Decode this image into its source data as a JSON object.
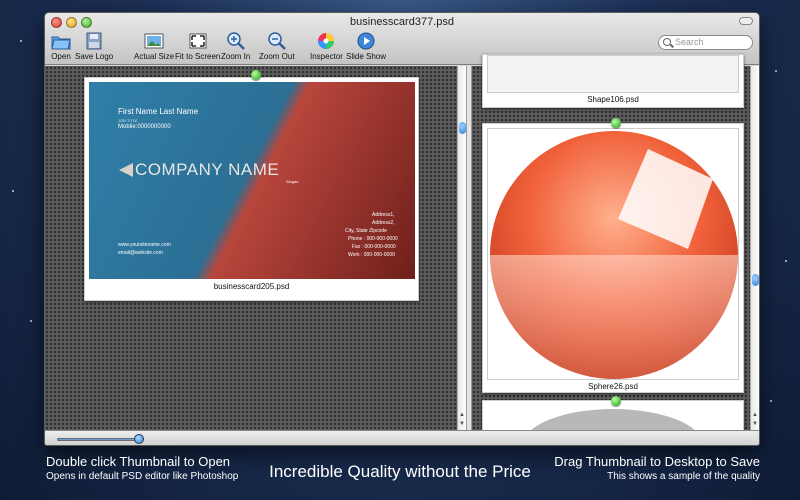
{
  "window": {
    "title": "businesscard377.psd"
  },
  "toolbar": {
    "open": "Open",
    "save_logo": "Save Logo",
    "actual_size": "Actual Size",
    "fit_to_screen": "Fit to Screen",
    "zoom_in": "Zoom In",
    "zoom_out": "Zoom Out",
    "inspector": "Inspector",
    "slide_show": "Slide Show"
  },
  "search": {
    "placeholder": "Search"
  },
  "left_pane": {
    "card": {
      "name": "First Name Last Name",
      "job_title": "JOB TITLE",
      "mobile": "Mobile:0000000000",
      "company": "COMPANY NAME",
      "slogan": "Slogan",
      "website": "www.yoursitename.com",
      "email": "email@website.com",
      "address1": "Address1,",
      "address2": "Address2,",
      "city": "City,   State   Zipcode",
      "phone": "Phone : 000-000-0000",
      "fax": "Fax : 000-000-0000",
      "work": "Work : 000-000-0000"
    },
    "filename": "businesscard205.psd"
  },
  "right_pane": {
    "top_filename": "Shape106.psd",
    "sphere_filename": "Sphere26.psd"
  },
  "slider": {
    "value": 0.9
  },
  "promo": {
    "left_line1": "Double click Thumbnail to Open",
    "left_line2": "Opens in default PSD editor like Photoshop",
    "center": "Incredible Quality without the Price",
    "right_line1": "Drag Thumbnail to Desktop to Save",
    "right_line2": "This shows a sample of the quality"
  }
}
